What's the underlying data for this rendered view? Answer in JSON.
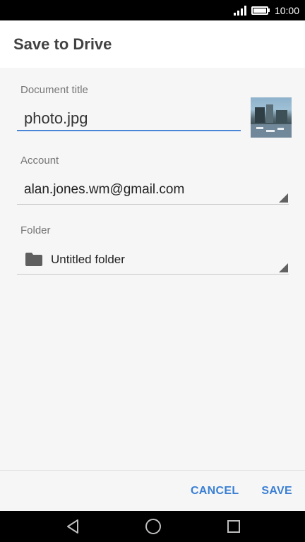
{
  "status_bar": {
    "time": "10:00",
    "icons": [
      "signal-icon",
      "battery-icon"
    ]
  },
  "header": {
    "title": "Save to Drive"
  },
  "form": {
    "document_title_label": "Document title",
    "document_title_value": "photo.jpg",
    "account_label": "Account",
    "account_value": "alan.jones.wm@gmail.com",
    "folder_label": "Folder",
    "folder_value": "Untitled folder",
    "folder_icon": "folder-icon"
  },
  "actions": {
    "cancel_label": "CANCEL",
    "save_label": "SAVE"
  },
  "nav": {
    "icons": [
      "back-icon",
      "home-icon",
      "recents-icon"
    ]
  },
  "colors": {
    "accent": "#3a7fd4",
    "input_underline": "#4a86d8",
    "background": "#f6f6f6",
    "header_background": "#ffffff"
  }
}
